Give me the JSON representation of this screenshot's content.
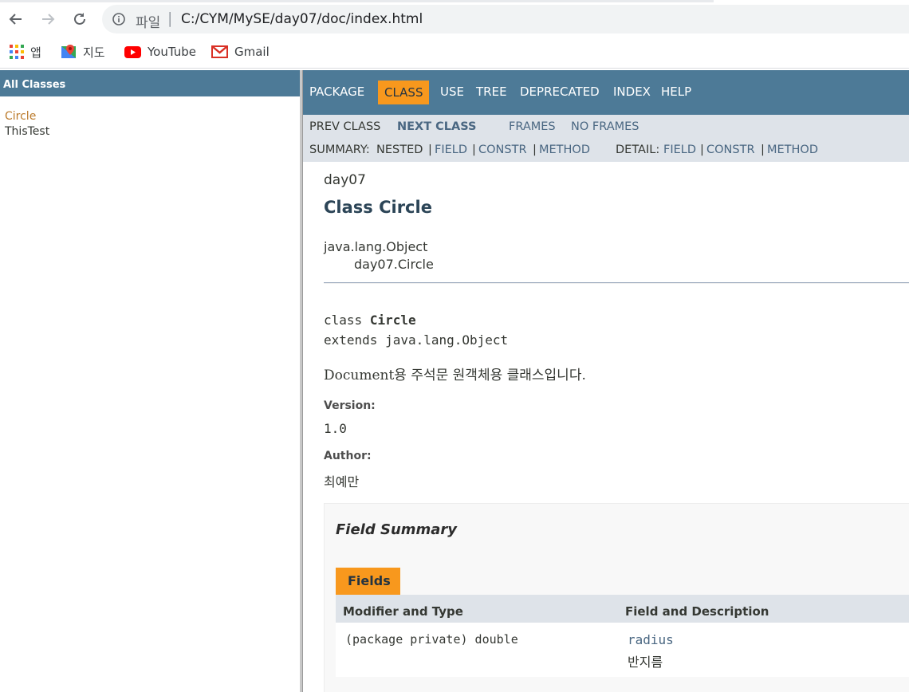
{
  "browser": {
    "scheme_label": "파일",
    "url": "C:/CYM/MySE/day07/doc/index.html",
    "bookmarks": [
      "앱",
      "지도",
      "YouTube",
      "Gmail"
    ]
  },
  "left_frame": {
    "header": "All Classes",
    "classes": [
      {
        "label": "Circle",
        "current": true
      },
      {
        "label": "ThisTest",
        "current": false
      }
    ]
  },
  "top_nav": {
    "items": [
      "PACKAGE",
      "CLASS",
      "USE",
      "TREE",
      "DEPRECATED",
      "INDEX",
      "HELP"
    ],
    "active": "CLASS"
  },
  "sub_nav": {
    "prev_class": "PREV CLASS",
    "next_class": "NEXT CLASS",
    "frames": "FRAMES",
    "no_frames": "NO FRAMES",
    "summary_label": "SUMMARY:",
    "summary_nested": "NESTED",
    "summary_field": "FIELD",
    "summary_constr": "CONSTR",
    "summary_method": "METHOD",
    "detail_label": "DETAIL:",
    "detail_field": "FIELD",
    "detail_constr": "CONSTR",
    "detail_method": "METHOD",
    "separator": "|"
  },
  "class_doc": {
    "package": "day07",
    "title": "Class Circle",
    "inheritance": [
      "java.lang.Object",
      "day07.Circle"
    ],
    "decl_keyword": "class",
    "decl_name": "Circle",
    "decl_extends": "extends java.lang.Object",
    "description": "Document용 주석문 원객체용 클래스입니다.",
    "version_label": "Version:",
    "version": "1.0",
    "author_label": "Author:",
    "author": "최예만"
  },
  "field_summary": {
    "title": "Field Summary",
    "tab": "Fields",
    "columns": [
      "Modifier and Type",
      "Field and Description"
    ],
    "rows": [
      {
        "type": "(package private) double",
        "name": "radius",
        "description": "반지름"
      }
    ]
  }
}
